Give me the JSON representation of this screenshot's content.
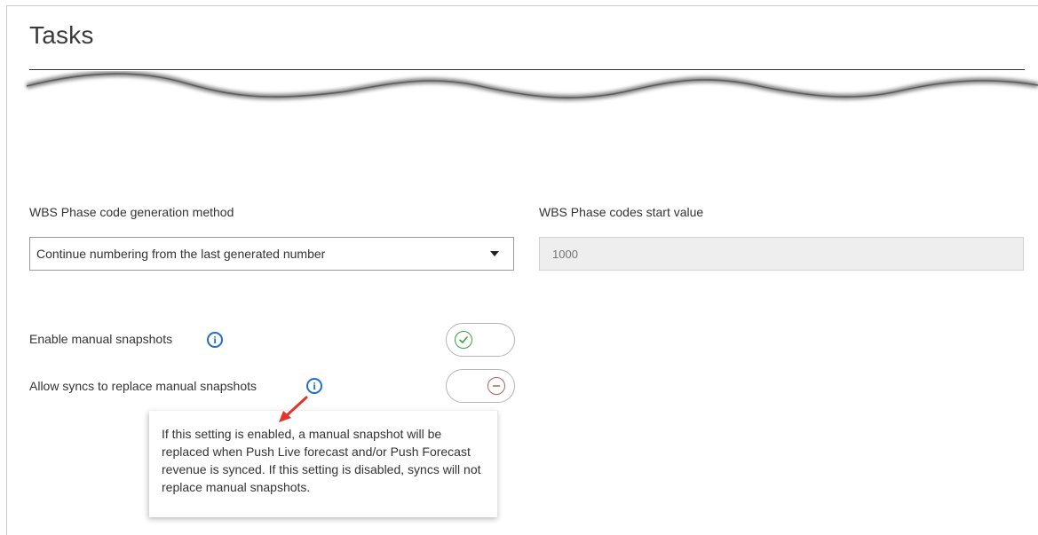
{
  "page": {
    "title": "Tasks"
  },
  "wbs": {
    "method_label": "WBS Phase code generation method",
    "method_value": "Continue numbering from the last generated number",
    "start_label": "WBS Phase codes start value",
    "start_placeholder": "1000"
  },
  "settings": {
    "manual_snapshots": {
      "label": "Enable manual snapshots",
      "toggle_state": "on"
    },
    "syncs_replace": {
      "label": "Allow syncs to replace manual snapshots",
      "toggle_state": "off"
    }
  },
  "tooltip": {
    "text": "If this setting is enabled, a manual snapshot will be replaced when Push Live forecast and/or Push Forecast revenue is synced. If this setting is disabled, syncs will not replace manual snapshots."
  },
  "colors": {
    "info_blue": "#1f6fd1",
    "toggle_on_green": "#3aa23a",
    "toggle_off_red": "#b0605e",
    "annotation_arrow_red": "#e0342d"
  },
  "icons": {
    "info": "info-icon",
    "check": "check-circle-icon",
    "minus": "minus-circle-icon",
    "caret": "caret-down-icon"
  }
}
